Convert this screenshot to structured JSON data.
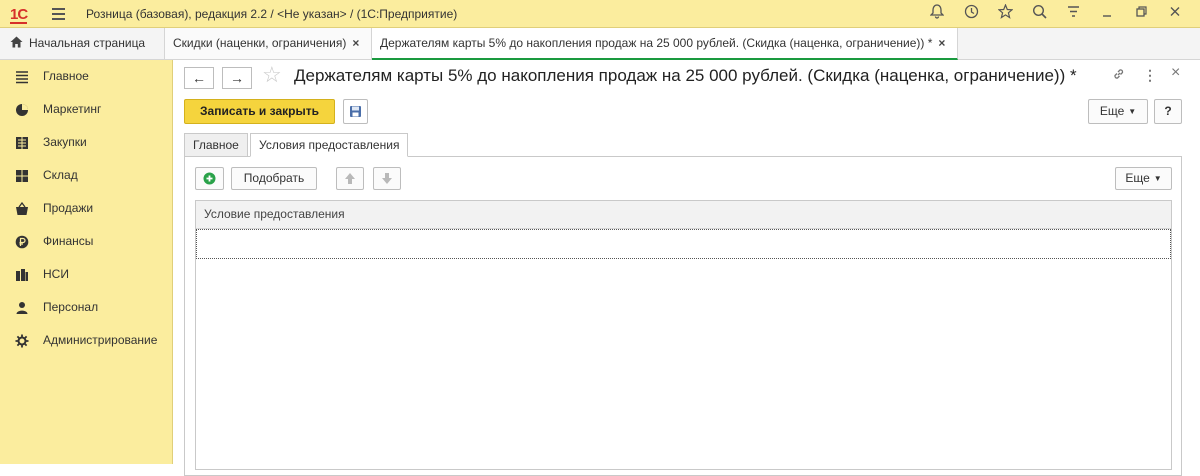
{
  "titlebar": {
    "logo": "1С",
    "app_title": "Розница (базовая), редакция 2.2 / <Не указан> /  (1С:Предприятие)",
    "icons": [
      "bell-icon",
      "history-icon",
      "star-icon",
      "search-icon",
      "settings-icon",
      "minimize-icon",
      "restore-icon",
      "close-icon"
    ]
  },
  "tabs": {
    "home": "Начальная страница",
    "tab1": "Скидки (наценки, ограничения)",
    "tab2": "Держателям карты 5% до накопления продаж на 25 000 рублей. (Скидка (наценка, ограничение)) *",
    "close_glyph": "×"
  },
  "sidebar": {
    "items": [
      {
        "label": "Главное",
        "icon": "menu-lines-icon"
      },
      {
        "label": "Маркетинг",
        "icon": "pie-chart-icon"
      },
      {
        "label": "Закупки",
        "icon": "purchases-icon"
      },
      {
        "label": "Склад",
        "icon": "warehouse-icon"
      },
      {
        "label": "Продажи",
        "icon": "basket-icon"
      },
      {
        "label": "Финансы",
        "icon": "ruble-coin-icon"
      },
      {
        "label": "НСИ",
        "icon": "reference-books-icon"
      },
      {
        "label": "Персонал",
        "icon": "person-icon"
      },
      {
        "label": "Администрирование",
        "icon": "gear-icon"
      }
    ]
  },
  "header": {
    "title": "Держателям карты 5% до накопления продаж на 25 000 рублей. (Скидка (наценка, ограничение)) *",
    "back_glyph": "←",
    "forward_glyph": "→",
    "star_glyph": "☆",
    "link_glyph": "🔗",
    "more_glyph": "⋮",
    "close_glyph": "×"
  },
  "commandbar": {
    "save_close": "Записать и закрыть",
    "more": "Еще",
    "help": "?"
  },
  "form_tabs": {
    "main": "Главное",
    "conditions": "Условия предоставления"
  },
  "table_toolbar": {
    "add_glyph": "+",
    "pick": "Подобрать",
    "up_glyph": "🡅",
    "down_glyph": "🡇",
    "more": "Еще"
  },
  "table": {
    "columns": [
      "Условие предоставления"
    ],
    "rows": []
  }
}
